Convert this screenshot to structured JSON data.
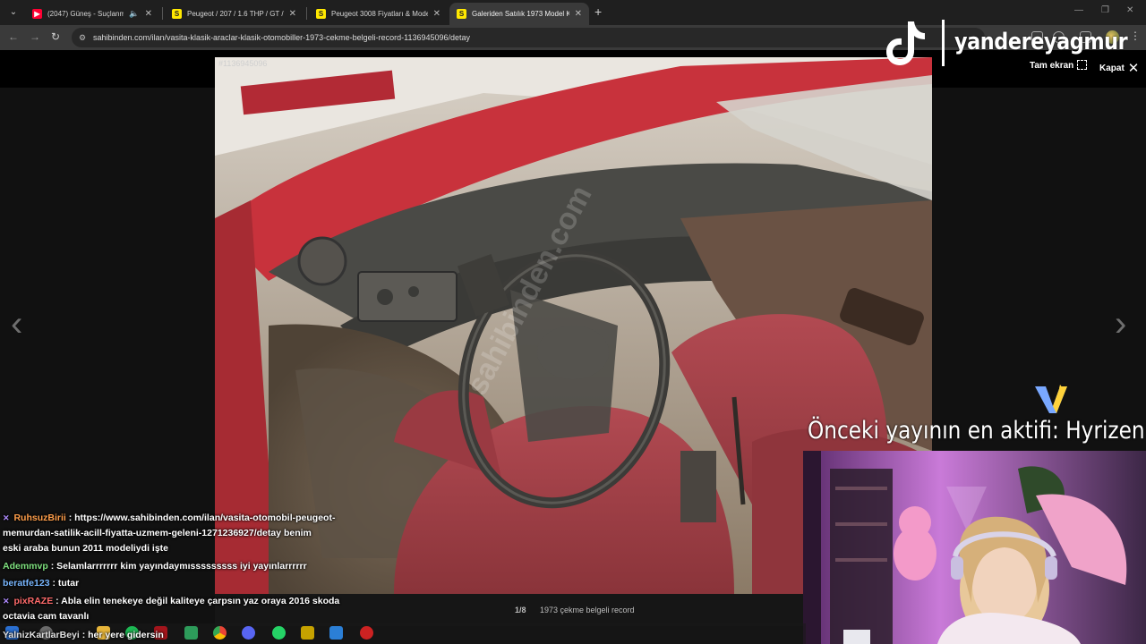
{
  "browser": {
    "tabs": [
      {
        "label": "(2047) Güneş - Suçlanmdan",
        "favicon": "youtube-icon",
        "active": false,
        "playing": true
      },
      {
        "label": "Peugeot / 207 / 1.6 THP / GT / 2",
        "favicon": "sahibinden-icon",
        "active": false
      },
      {
        "label": "Peugeot 3008 Fiyatları & Model",
        "favicon": "sahibinden-icon",
        "active": false
      },
      {
        "label": "Galeriden Satılık 1973 Model K",
        "favicon": "sahibinden-icon",
        "active": true
      }
    ],
    "favicon_letter": "S",
    "url": "sahibinden.com/ilan/vasita-klasik-araclar-klasik-otomobiller-1973-cekme-belgeli-record-1136945096/detay"
  },
  "lightbox": {
    "listing_id": "#1136945096",
    "fullscreen_label": "Tam ekran",
    "close_label": "Kapat",
    "counter": "1/8",
    "caption": "1973 çekme belgeli record"
  },
  "overlay": {
    "handle": "yandereyagmur",
    "top_chatter": "Önceki yayının en aktifi: Hyrizen"
  },
  "chat": [
    {
      "user": "RuhsuzBirii",
      "user_color": "#ff9e4a",
      "lines": [
        ": https://www.sahibinden.com/ilan/vasita-otomobil-peugeot-",
        "memurdan-satilik-acill-fiyatta-uzmem-geleni-1271236927/detay benim",
        "eski araba bunun 2011 modeliydi işte"
      ]
    },
    {
      "user": "Ademmvp",
      "user_color": "#7ee07e",
      "lines": [
        ": Selamlarrrrrrr kim yayındaymısssssssss iyi yayınlarrrrrr"
      ]
    },
    {
      "user": "beratfe123",
      "user_color": "#79b7ff",
      "lines": [
        ": tutar"
      ]
    },
    {
      "user": "pixRAZE",
      "user_color": "#ff6b6b",
      "lines": [
        ": Abla elin tenekeye değil kaliteye çarpsın yaz oraya 2016 skoda",
        "octavia cam tavanlı"
      ]
    },
    {
      "user": "YalnizKartlarBeyi",
      "user_color": "#e0e0e0",
      "lines": [
        ": her yere gidersin"
      ]
    }
  ],
  "colors": {
    "accent_red": "#c8323c",
    "seat_red": "#a8434a",
    "webcam_purple": "#b03bd6"
  }
}
